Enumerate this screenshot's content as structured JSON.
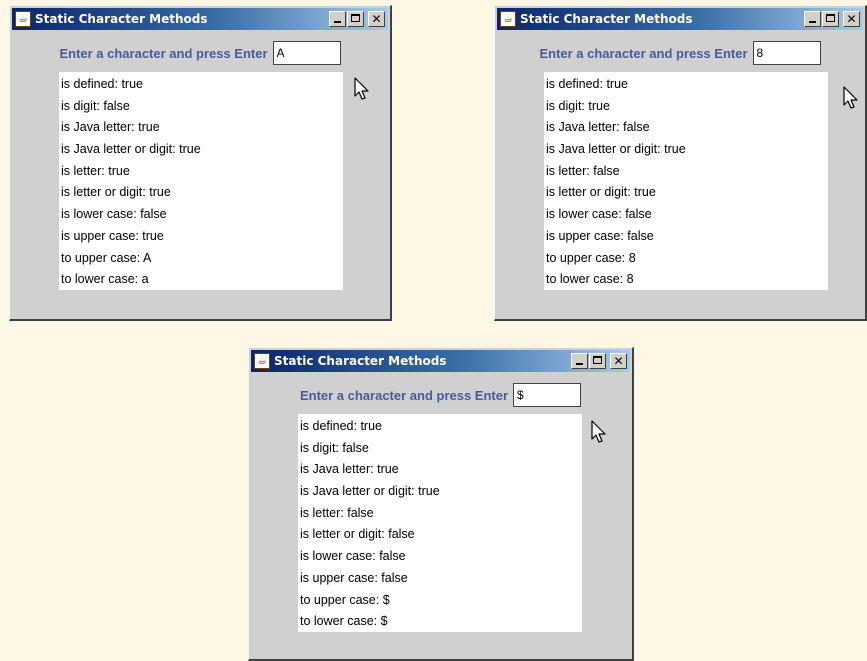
{
  "windows": [
    {
      "title": "Static Character Methods",
      "app_icon": "java-cup-icon",
      "prompt": "Enter a character and press Enter",
      "input_value": "A",
      "results": [
        "is defined: true",
        "is digit: false",
        "is Java letter: true",
        "is Java letter or digit: true",
        "is letter: true",
        "is letter or digit: true",
        "is lower case: false",
        "is upper case: true",
        "to upper case: A",
        "to lower case: a"
      ]
    },
    {
      "title": "Static Character Methods",
      "app_icon": "java-cup-icon",
      "prompt": "Enter a character and press Enter",
      "input_value": "8",
      "results": [
        "is defined: true",
        "is digit: true",
        "is Java letter: false",
        "is Java letter or digit: true",
        "is letter: false",
        "is letter or digit: true",
        "is lower case: false",
        "is upper case: false",
        "to upper case: 8",
        "to lower case: 8"
      ]
    },
    {
      "title": "Static Character Methods",
      "app_icon": "java-cup-icon",
      "prompt": "Enter a character and press Enter",
      "input_value": "$",
      "results": [
        "is defined: true",
        "is digit: false",
        "is Java letter: true",
        "is Java letter or digit: true",
        "is letter: false",
        "is letter or digit: false",
        "is lower case: false",
        "is upper case: false",
        "to upper case: $",
        "to lower case: $"
      ]
    }
  ],
  "colors": {
    "page_background": "#fdf8e6",
    "window_background": "#d0d0d0",
    "titlebar_start": "#0a246a",
    "titlebar_end": "#a6caf0",
    "prompt_text": "#4a5a9a"
  }
}
